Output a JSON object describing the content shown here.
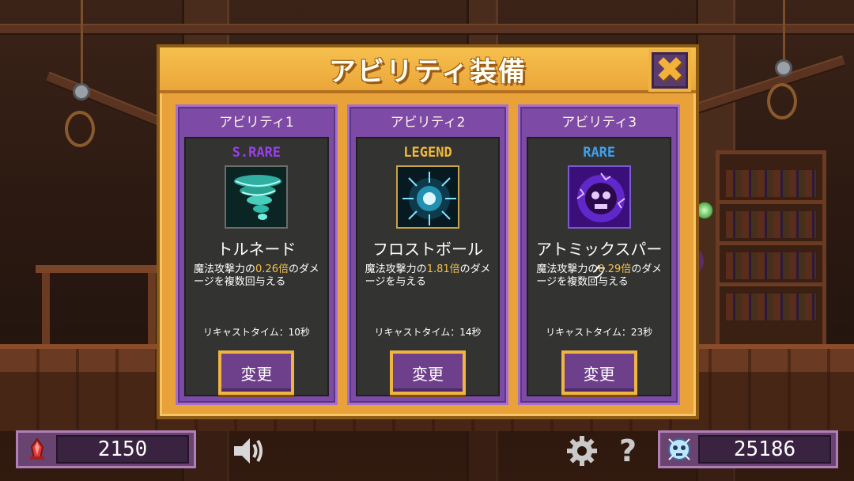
{
  "modal": {
    "title": "アビリティ装備",
    "close_label": "✖"
  },
  "abilities": [
    {
      "slot_label": "アビリティ1",
      "rarity": "S.RARE",
      "rarity_color": "#9b3df0",
      "icon": "tornado-icon",
      "name": "トルネード",
      "desc_prefix": "魔法攻撃力の",
      "desc_value": "0.26倍",
      "desc_suffix": "のダメージを複数回与える",
      "recast": "リキャストタイム：10秒",
      "button_label": "変更"
    },
    {
      "slot_label": "アビリティ2",
      "rarity": "LEGEND",
      "rarity_color": "#f0b83a",
      "icon": "frost-ball-icon",
      "name": "フロストボール",
      "desc_prefix": "魔法攻撃力の",
      "desc_value": "1.81倍",
      "desc_suffix": "のダメージを与える",
      "recast": "リキャストタイム：14秒",
      "button_label": "変更"
    },
    {
      "slot_label": "アビリティ3",
      "rarity": "RARE",
      "rarity_color": "#3ea0f0",
      "icon": "atomic-spark-icon",
      "name": "アトミックスパーク",
      "desc_prefix": "魔法攻撃力の",
      "desc_value": "0.29倍",
      "desc_suffix": "のダメージを複数回与える",
      "recast": "リキャストタイム：23秒",
      "button_label": "変更"
    }
  ],
  "hud": {
    "left_value": "2150",
    "left_icon": "red-crystal-icon",
    "right_value": "25186",
    "right_icon": "skull-gem-icon",
    "sound_icon": "speaker-icon",
    "settings_icon": "gear-icon",
    "help_label": "?"
  }
}
